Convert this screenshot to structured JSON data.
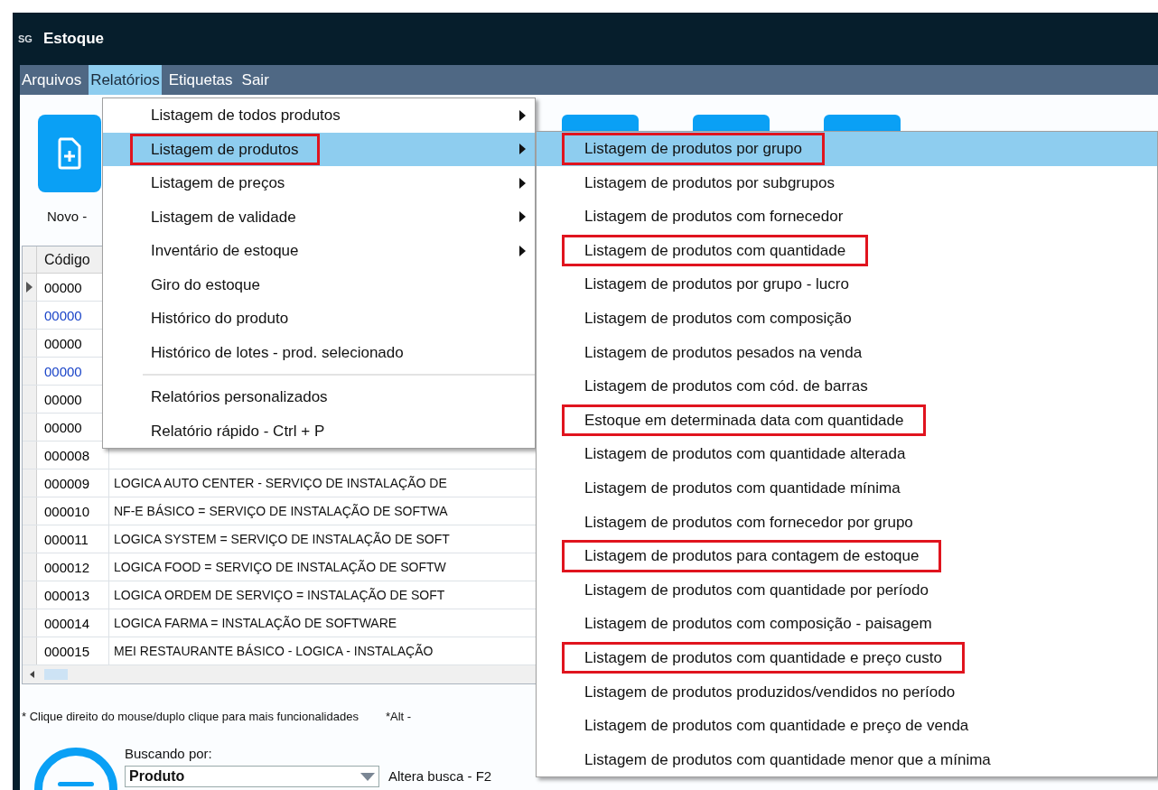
{
  "window": {
    "logo": "SG",
    "title": "Estoque"
  },
  "menu_bar": [
    {
      "label": "Arquivos",
      "selected": false
    },
    {
      "label": "Relatórios",
      "selected": true
    },
    {
      "label": "Etiquetas",
      "selected": false
    },
    {
      "label": "Sair",
      "selected": false
    }
  ],
  "toolbar": {
    "new_label": "Novo -"
  },
  "table": {
    "columns": [
      "Código"
    ],
    "rows": [
      {
        "code": "00000",
        "name": "",
        "selected": true,
        "color": "#000000"
      },
      {
        "code": "00000",
        "name": "",
        "selected": false,
        "color": "#1a44c8"
      },
      {
        "code": "00000",
        "name": "",
        "selected": false,
        "color": "#000000"
      },
      {
        "code": "00000",
        "name": "",
        "selected": false,
        "color": "#1a44c8"
      },
      {
        "code": "00000",
        "name": "",
        "selected": false,
        "color": "#000000"
      },
      {
        "code": "00000",
        "name": "",
        "selected": false,
        "color": "#000000"
      },
      {
        "code": "000008",
        "name": "",
        "selected": false,
        "color": "#000000"
      },
      {
        "code": "000009",
        "name": "LOGICA AUTO CENTER - SERVIÇO DE INSTALAÇÃO DE",
        "selected": false,
        "color": "#000000"
      },
      {
        "code": "000010",
        "name": "NF-E BÁSICO = SERVIÇO DE INSTALAÇÃO DE SOFTWA",
        "selected": false,
        "color": "#000000"
      },
      {
        "code": "000011",
        "name": "LOGICA SYSTEM = SERVIÇO DE INSTALAÇÃO DE SOFT",
        "selected": false,
        "color": "#000000"
      },
      {
        "code": "000012",
        "name": "LOGICA FOOD = SERVIÇO DE INSTALAÇÃO DE SOFTW",
        "selected": false,
        "color": "#000000"
      },
      {
        "code": "000013",
        "name": "LOGICA ORDEM DE SERVIÇO = INSTALAÇÃO DE SOFT",
        "selected": false,
        "color": "#000000"
      },
      {
        "code": "000014",
        "name": "LOGICA FARMA = INSTALAÇÃO DE SOFTWARE",
        "selected": false,
        "color": "#000000"
      },
      {
        "code": "000015",
        "name": "MEI RESTAURANTE BÁSICO - LOGICA - INSTALAÇÃO",
        "selected": false,
        "color": "#000000"
      }
    ]
  },
  "hint": "* Clique direito do mouse/duplo clique para mais funcionalidades",
  "hint_2": "*Alt -",
  "search": {
    "label": "Buscando por:",
    "value": "Produto",
    "shortcut": "Altera busca - F2"
  },
  "reports_menu": [
    {
      "label": "Listagem de todos produtos",
      "submenu": true,
      "selected": false,
      "highlighted": false
    },
    {
      "label": "Listagem de produtos",
      "submenu": true,
      "selected": true,
      "highlighted": true
    },
    {
      "label": "Listagem de preços",
      "submenu": true,
      "selected": false,
      "highlighted": false
    },
    {
      "label": "Listagem de validade",
      "submenu": true,
      "selected": false,
      "highlighted": false
    },
    {
      "label": "Inventário de estoque",
      "submenu": true,
      "selected": false,
      "highlighted": false
    },
    {
      "label": "Giro do estoque",
      "submenu": false,
      "selected": false,
      "highlighted": false
    },
    {
      "label": "Histórico do produto",
      "submenu": false,
      "selected": false,
      "highlighted": false
    },
    {
      "label": "Histórico de lotes - prod. selecionado",
      "submenu": false,
      "selected": false,
      "highlighted": false
    },
    {
      "kind": "separator"
    },
    {
      "label": "Relatórios personalizados",
      "submenu": false,
      "selected": false,
      "highlighted": false
    },
    {
      "label": "Relatório rápido - Ctrl + P",
      "submenu": false,
      "selected": false,
      "highlighted": false
    }
  ],
  "products_submenu": [
    {
      "label": "Listagem de produtos por grupo",
      "selected": true,
      "highlighted": true
    },
    {
      "label": "Listagem de produtos por subgrupos",
      "selected": false,
      "highlighted": false
    },
    {
      "label": "Listagem de produtos com fornecedor",
      "selected": false,
      "highlighted": false
    },
    {
      "label": "Listagem de produtos com quantidade",
      "selected": false,
      "highlighted": true
    },
    {
      "label": "Listagem de produtos por grupo - lucro",
      "selected": false,
      "highlighted": false
    },
    {
      "label": "Listagem de produtos com composição",
      "selected": false,
      "highlighted": false
    },
    {
      "label": "Listagem de produtos pesados na venda",
      "selected": false,
      "highlighted": false
    },
    {
      "label": "Listagem de produtos com cód. de barras",
      "selected": false,
      "highlighted": false
    },
    {
      "label": "Estoque em determinada data com quantidade",
      "selected": false,
      "highlighted": true
    },
    {
      "label": "Listagem de produtos com quantidade alterada",
      "selected": false,
      "highlighted": false
    },
    {
      "label": "Listagem de produtos com quantidade mínima",
      "selected": false,
      "highlighted": false
    },
    {
      "label": "Listagem de produtos com fornecedor por grupo",
      "selected": false,
      "highlighted": false
    },
    {
      "label": "Listagem de produtos para contagem de estoque",
      "selected": false,
      "highlighted": true
    },
    {
      "label": "Listagem de produtos com quantidade por período",
      "selected": false,
      "highlighted": false
    },
    {
      "label": "Listagem de produtos com composição - paisagem",
      "selected": false,
      "highlighted": false
    },
    {
      "label": "Listagem de produtos com quantidade e preço custo",
      "selected": false,
      "highlighted": true
    },
    {
      "label": "Listagem de produtos produzidos/vendidos no período",
      "selected": false,
      "highlighted": false
    },
    {
      "label": "Listagem de produtos com quantidade e preço de venda",
      "selected": false,
      "highlighted": false
    },
    {
      "label": "Listagem de produtos com quantidade menor que a mínima",
      "selected": false,
      "highlighted": false
    }
  ]
}
